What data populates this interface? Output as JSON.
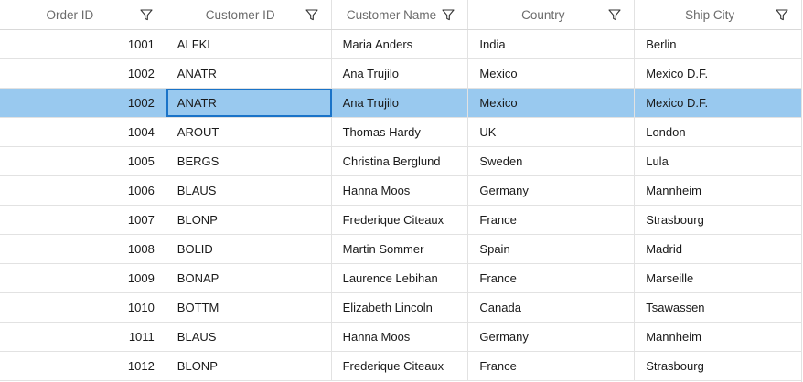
{
  "columns": [
    {
      "label": "Order ID"
    },
    {
      "label": "Customer ID"
    },
    {
      "label": "Customer Name"
    },
    {
      "label": "Country"
    },
    {
      "label": "Ship City"
    }
  ],
  "rows": [
    {
      "order_id": "1001",
      "customer_id": "ALFKI",
      "customer_name": "Maria Anders",
      "country": "India",
      "ship_city": "Berlin",
      "selected": false
    },
    {
      "order_id": "1002",
      "customer_id": "ANATR",
      "customer_name": "Ana Trujilo",
      "country": "Mexico",
      "ship_city": "Mexico D.F.",
      "selected": false
    },
    {
      "order_id": "1002",
      "customer_id": "ANATR",
      "customer_name": "Ana Trujilo",
      "country": "Mexico",
      "ship_city": "Mexico D.F.",
      "selected": true
    },
    {
      "order_id": "1004",
      "customer_id": "AROUT",
      "customer_name": "Thomas Hardy",
      "country": "UK",
      "ship_city": "London",
      "selected": false
    },
    {
      "order_id": "1005",
      "customer_id": "BERGS",
      "customer_name": "Christina Berglund",
      "country": "Sweden",
      "ship_city": "Lula",
      "selected": false
    },
    {
      "order_id": "1006",
      "customer_id": "BLAUS",
      "customer_name": "Hanna Moos",
      "country": "Germany",
      "ship_city": "Mannheim",
      "selected": false
    },
    {
      "order_id": "1007",
      "customer_id": "BLONP",
      "customer_name": "Frederique Citeaux",
      "country": "France",
      "ship_city": "Strasbourg",
      "selected": false
    },
    {
      "order_id": "1008",
      "customer_id": "BOLID",
      "customer_name": "Martin Sommer",
      "country": "Spain",
      "ship_city": "Madrid",
      "selected": false
    },
    {
      "order_id": "1009",
      "customer_id": "BONAP",
      "customer_name": "Laurence Lebihan",
      "country": "France",
      "ship_city": "Marseille",
      "selected": false
    },
    {
      "order_id": "1010",
      "customer_id": "BOTTM",
      "customer_name": "Elizabeth Lincoln",
      "country": "Canada",
      "ship_city": "Tsawassen",
      "selected": false
    },
    {
      "order_id": "1011",
      "customer_id": "BLAUS",
      "customer_name": "Hanna Moos",
      "country": "Germany",
      "ship_city": "Mannheim",
      "selected": false
    },
    {
      "order_id": "1012",
      "customer_id": "BLONP",
      "customer_name": "Frederique Citeaux",
      "country": "France",
      "ship_city": "Strasbourg",
      "selected": false
    }
  ],
  "focused_cell": {
    "row": 2,
    "column": "customer_id"
  },
  "icons": {
    "filter": "filter-icon"
  },
  "colors": {
    "selected_row": "#99c9ef",
    "focus_border": "#1a73c8",
    "header_text": "#6b6b6b",
    "grid_line": "#e2e2e2"
  }
}
